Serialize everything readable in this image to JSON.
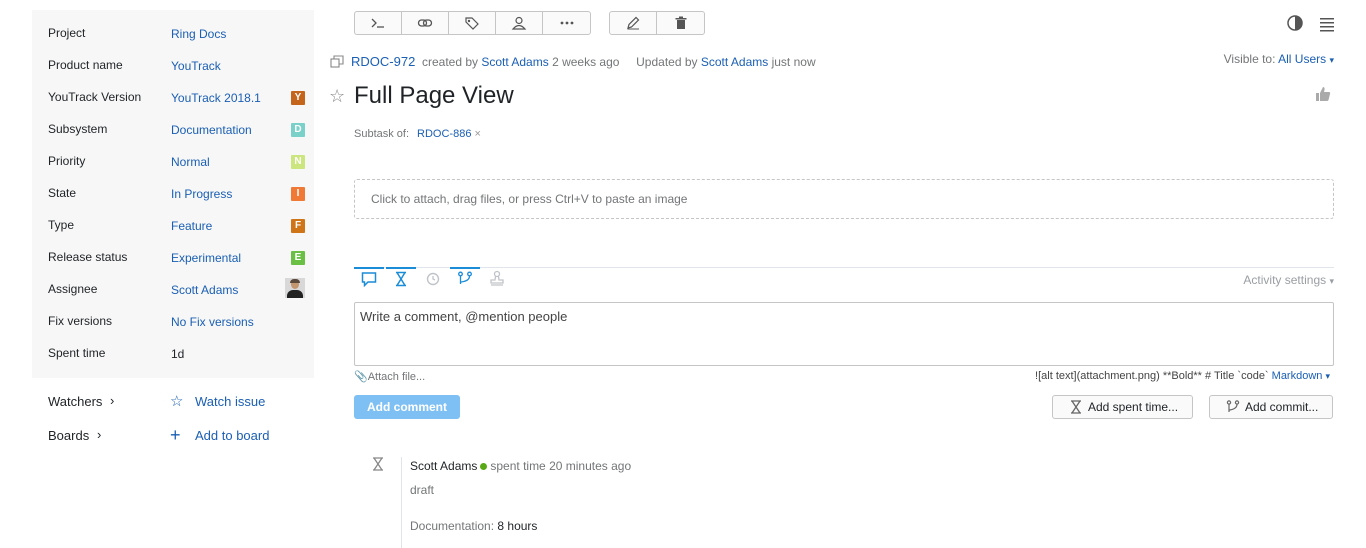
{
  "sidebar": {
    "fields": [
      {
        "label": "Project",
        "value": "Ring Docs"
      },
      {
        "label": "Product name",
        "value": "YouTrack"
      },
      {
        "label": "YouTrack Version",
        "value": "YouTrack 2018.1",
        "badge": "Y",
        "badge_color": "#c4651b"
      },
      {
        "label": "Subsystem",
        "value": "Documentation",
        "badge": "D",
        "badge_color": "#79d1c9"
      },
      {
        "label": "Priority",
        "value": "Normal",
        "badge": "N",
        "badge_color": "#cbe57f"
      },
      {
        "label": "State",
        "value": "In Progress",
        "badge": "I",
        "badge_color": "#f07936"
      },
      {
        "label": "Type",
        "value": "Feature",
        "badge": "F",
        "badge_color": "#d07418"
      },
      {
        "label": "Release status",
        "value": "Experimental",
        "badge": "E",
        "badge_color": "#6abf45"
      },
      {
        "label": "Assignee",
        "value": "Scott Adams"
      },
      {
        "label": "Fix versions",
        "value": "No Fix versions"
      },
      {
        "label": "Spent time",
        "value": "1d"
      }
    ],
    "watchers_label": "Watchers",
    "watch_issue_label": "Watch issue",
    "boards_label": "Boards",
    "add_to_board_label": "Add to board"
  },
  "toolbar": {
    "icons": [
      "console-icon",
      "link-icon",
      "tag-icon",
      "user-icon",
      "more-icon"
    ],
    "edit_icons": [
      "pencil-icon",
      "trash-icon"
    ]
  },
  "issue": {
    "id": "RDOC-972",
    "created_by_prefix": "created by",
    "creator": "Scott Adams",
    "created_ago": "2 weeks ago",
    "updated_prefix": "Updated by",
    "updater": "Scott Adams",
    "updated_ago": "just now",
    "visible_to_label": "Visible to:",
    "visible_to_value": "All Users",
    "title": "Full Page View",
    "subtask_label": "Subtask of:",
    "subtask_id": "RDOC-886",
    "subtask_remove": "×"
  },
  "dropzone_text": "Click to attach, drag files, or press Ctrl+V to paste an image",
  "activity": {
    "settings_label": "Activity settings",
    "comment_placeholder": "Write a comment, @mention people",
    "attach_file": "Attach file...",
    "markdown_hint": "![alt text](attachment.png) **Bold** # Title `code`",
    "markdown_label": "Markdown",
    "add_comment": "Add comment",
    "add_spent_time": "Add spent time...",
    "add_commit": "Add commit..."
  },
  "activity_item": {
    "author": "Scott Adams",
    "action": "spent time 20 minutes ago",
    "body": "draft",
    "work_label": "Documentation:",
    "work_value": "8 hours"
  }
}
